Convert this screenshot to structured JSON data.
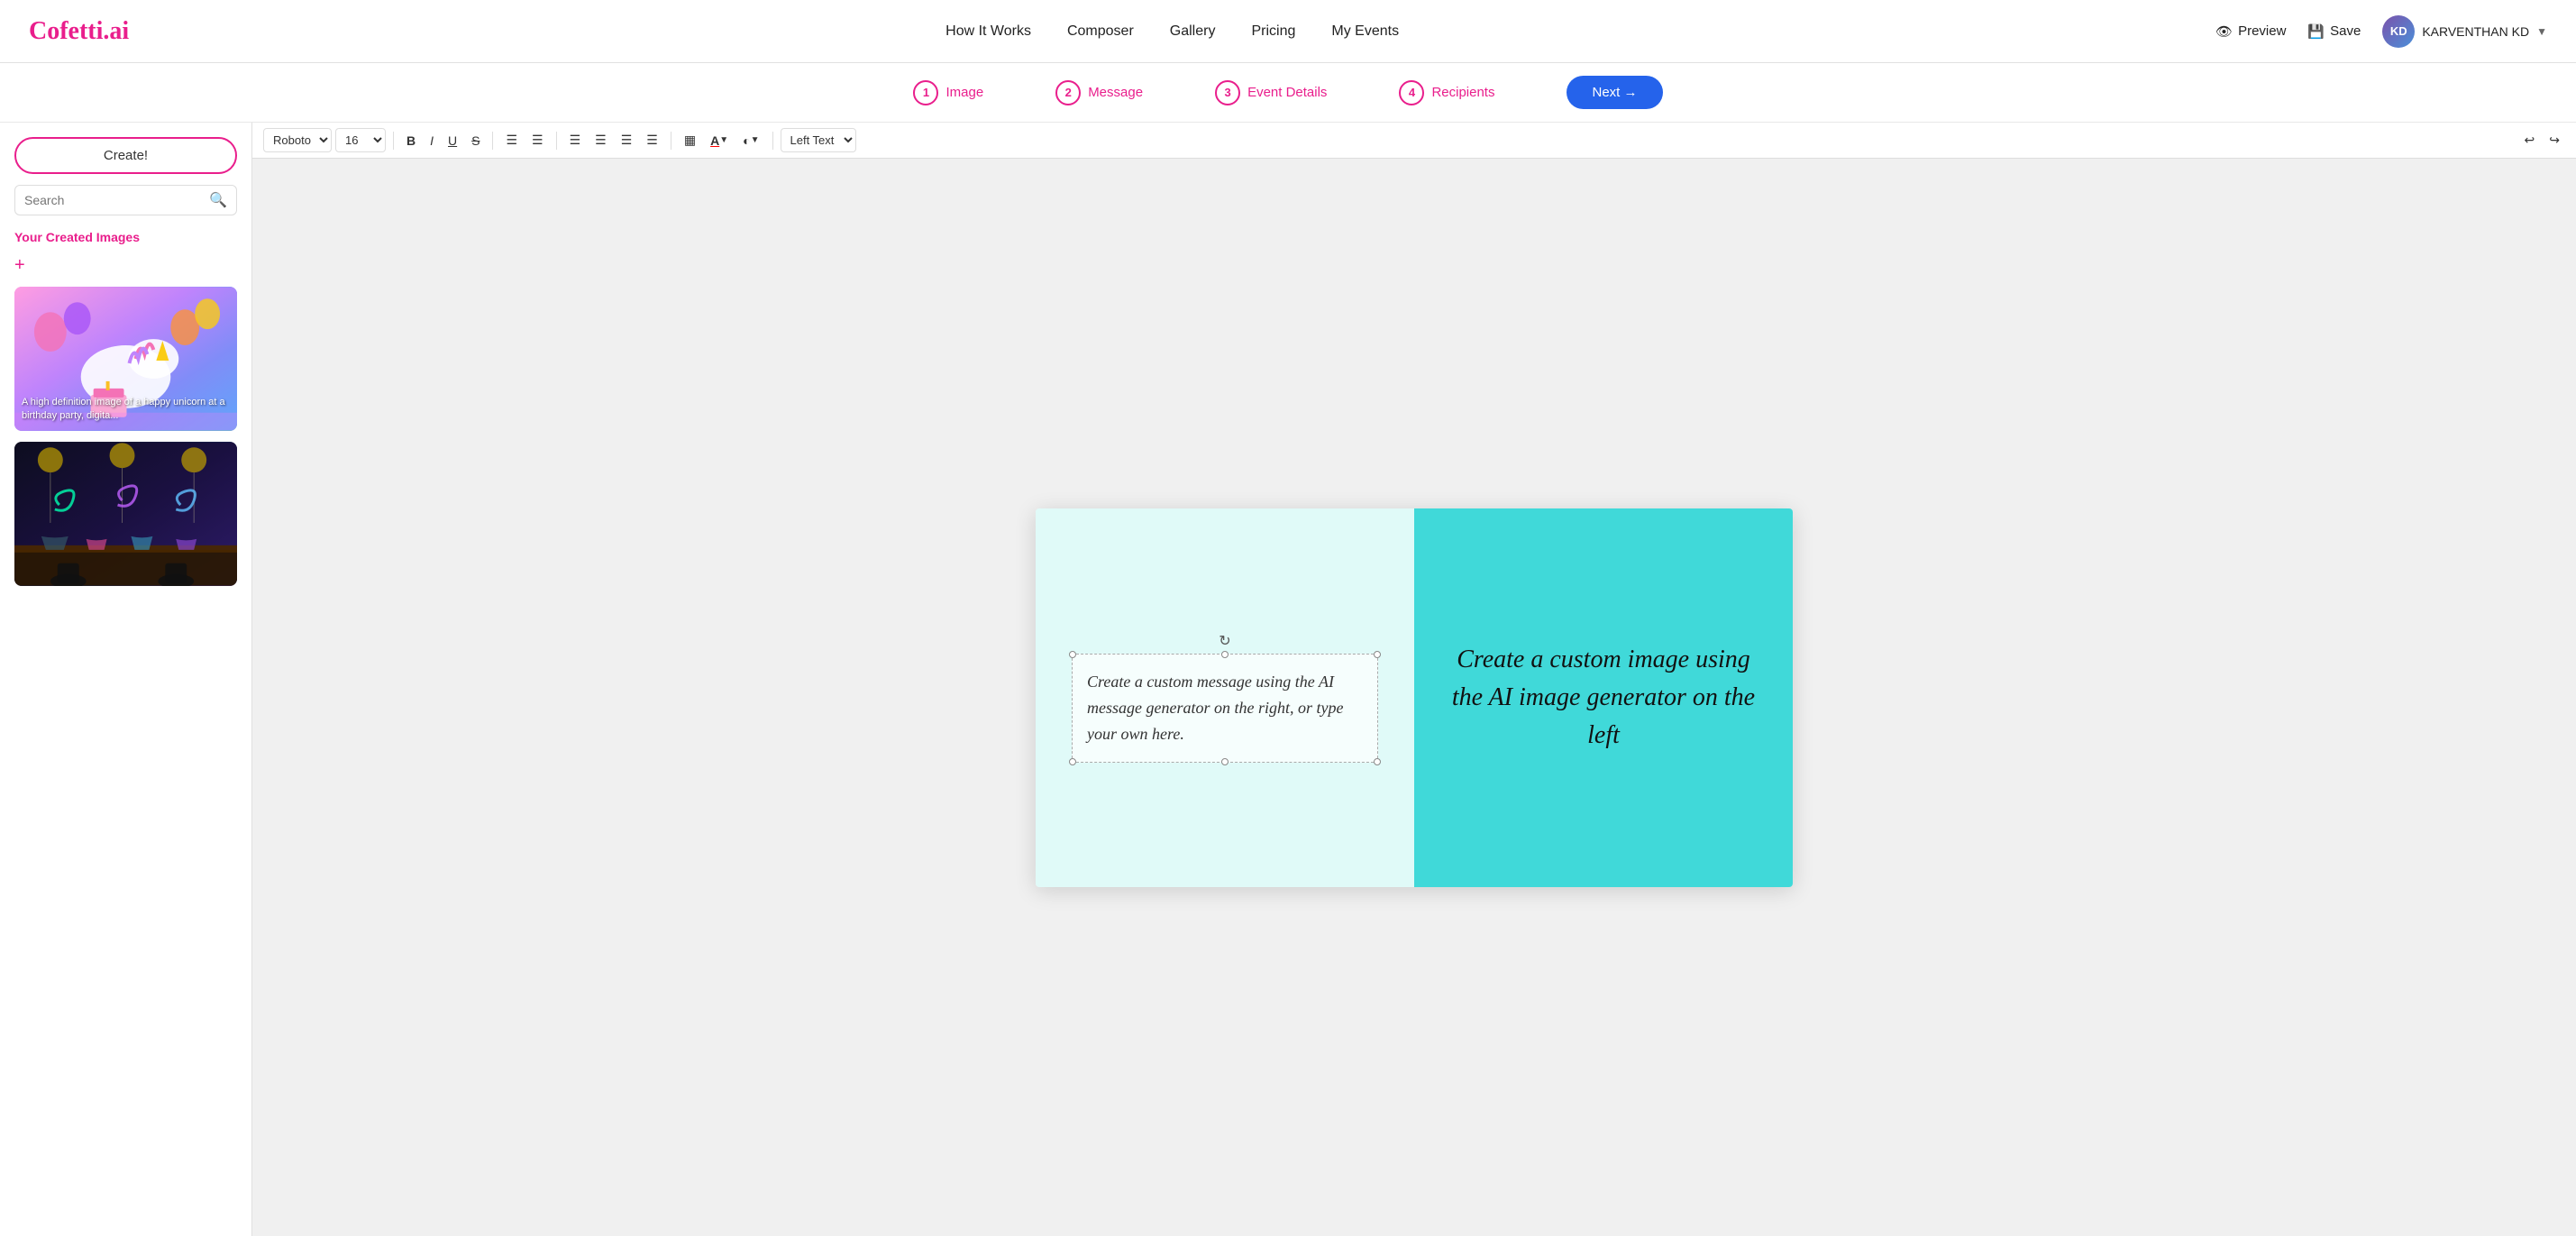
{
  "header": {
    "logo": "Cofetti.ai",
    "nav": [
      {
        "id": "how-it-works",
        "label": "How It Works"
      },
      {
        "id": "composer",
        "label": "Composer"
      },
      {
        "id": "gallery",
        "label": "Gallery"
      },
      {
        "id": "pricing",
        "label": "Pricing"
      },
      {
        "id": "my-events",
        "label": "My Events"
      }
    ],
    "preview_label": "Preview",
    "save_label": "Save",
    "user_name": "KARVENTHAN KD",
    "user_initials": "KD"
  },
  "steps": [
    {
      "number": "1",
      "label": "Image"
    },
    {
      "number": "2",
      "label": "Message"
    },
    {
      "number": "3",
      "label": "Event Details"
    },
    {
      "number": "4",
      "label": "Recipients"
    }
  ],
  "next_button": "Next →",
  "sidebar": {
    "create_button": "Create!",
    "search_placeholder": "Search",
    "section_title": "Your Created Images",
    "add_label": "+",
    "image1_caption": "A high definition image of a happy unicorn at a birthday party, digita...",
    "image2_caption": ""
  },
  "toolbar": {
    "font": "Roboto",
    "font_size": "16",
    "bold": "B",
    "italic": "I",
    "underline": "U",
    "strikethrough": "S",
    "ordered_list": "≡",
    "unordered_list": "≡",
    "align_left": "≡",
    "align_center": "≡",
    "align_right": "≡",
    "justify": "≡",
    "text_color_label": "A",
    "highlight_label": "◑",
    "text_direction": "Left Text",
    "undo": "↩",
    "redo": "↪"
  },
  "canvas": {
    "left_bg": "#e0faf8",
    "right_bg": "#40d9d9",
    "text_box_content": "Create a custom message using the AI message generator on the right, or type your own here.",
    "right_text": "Create a custom image using the AI image generator on the left"
  }
}
